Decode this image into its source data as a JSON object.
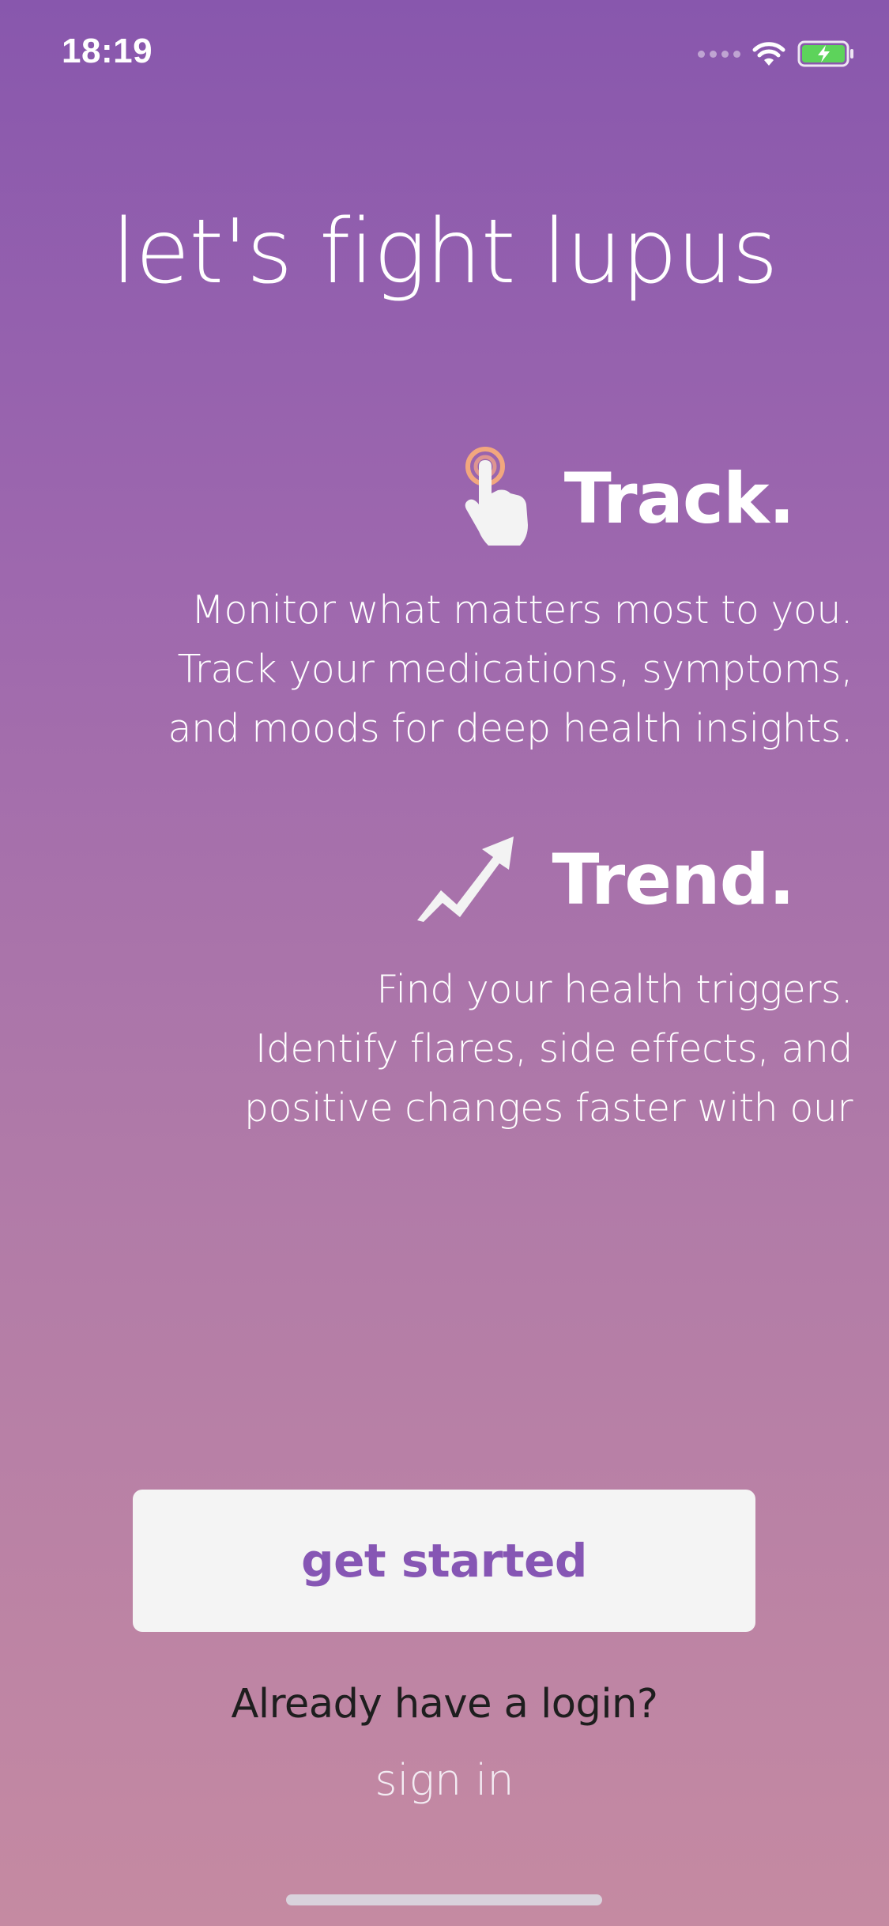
{
  "status_bar": {
    "time": "18:19",
    "icons": [
      "cellular-signal-icon",
      "wifi-icon",
      "battery-charging-icon"
    ]
  },
  "headline": "let's fight lupus",
  "features": [
    {
      "title": "Track.",
      "icon": "tap-finger-icon",
      "description": [
        "Monitor what matters most to you.",
        "Track your medications, symptoms,",
        "and moods for deep health insights."
      ]
    },
    {
      "title": "Trend.",
      "icon": "trend-arrow-icon",
      "description": [
        "Find your health triggers.",
        "Identify flares, side effects, and",
        "positive changes faster with our"
      ]
    }
  ],
  "actions": {
    "get_started_label": "get started",
    "login_prompt": "Already have a login?",
    "sign_in_label": "sign in"
  },
  "colors": {
    "gradient_top": "#8857AD",
    "gradient_bottom": "#C58AA2",
    "button_background": "#f4f4f4",
    "button_text": "#8656B4",
    "battery_fill": "#5DD35B",
    "tap_ring": "#F2A77E"
  }
}
